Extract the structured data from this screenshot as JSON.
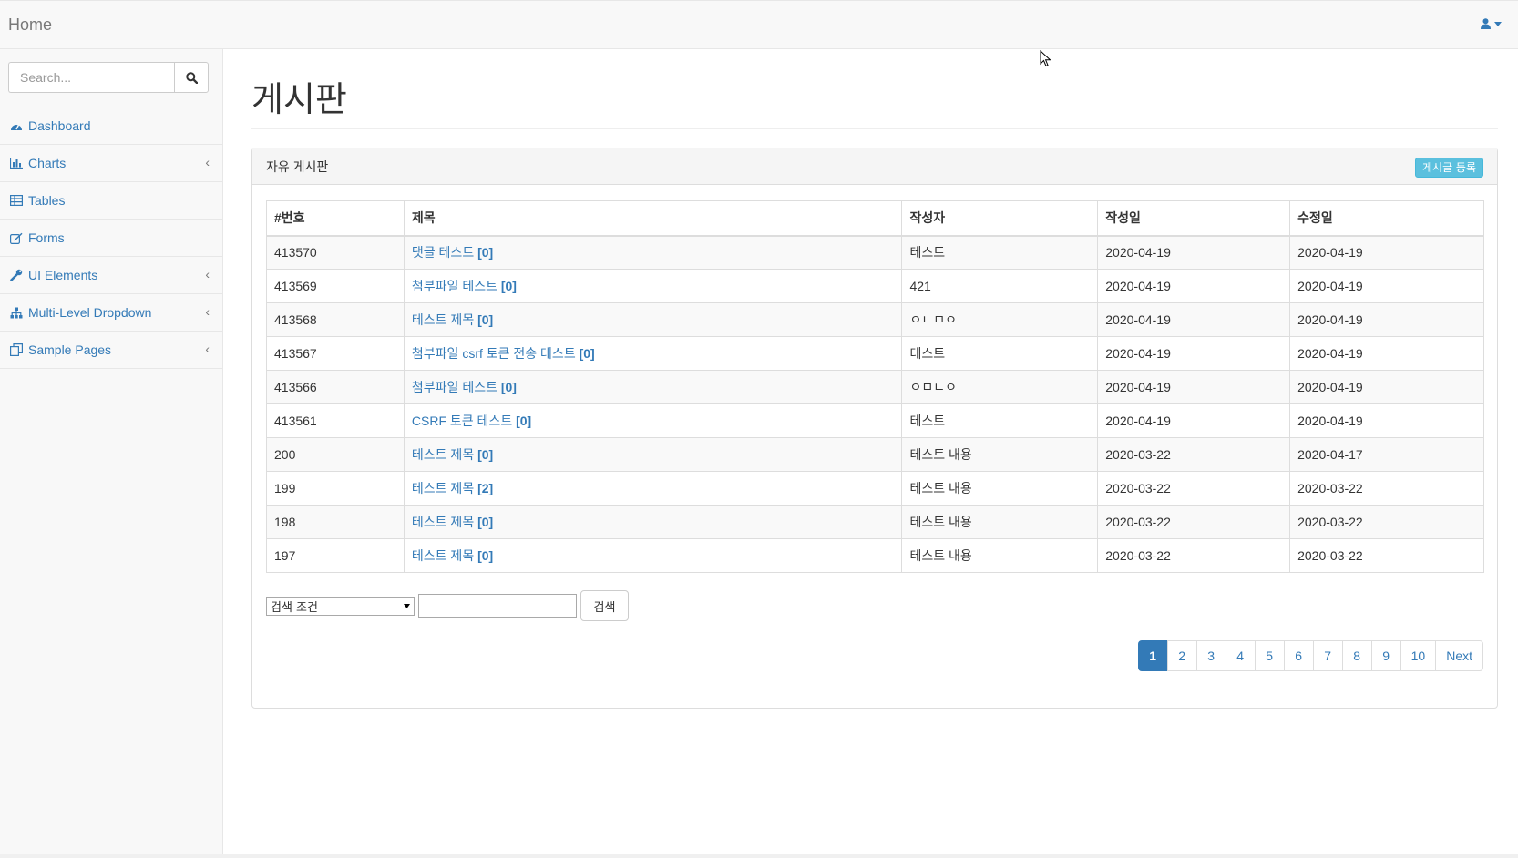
{
  "navbar": {
    "brand": "Home"
  },
  "sidebar": {
    "search_placeholder": "Search...",
    "items": [
      {
        "label": "Dashboard",
        "icon": "dashboard-icon",
        "has_children": false
      },
      {
        "label": "Charts",
        "icon": "bar-chart-icon",
        "has_children": true
      },
      {
        "label": "Tables",
        "icon": "table-icon",
        "has_children": false
      },
      {
        "label": "Forms",
        "icon": "edit-icon",
        "has_children": false
      },
      {
        "label": "UI Elements",
        "icon": "wrench-icon",
        "has_children": true
      },
      {
        "label": "Multi-Level Dropdown",
        "icon": "sitemap-icon",
        "has_children": true
      },
      {
        "label": "Sample Pages",
        "icon": "files-icon",
        "has_children": true
      }
    ]
  },
  "page": {
    "title": "게시판"
  },
  "board": {
    "heading": "자유 게시판",
    "register_label": "게시글 등록",
    "columns": [
      "#번호",
      "제목",
      "작성자",
      "작성일",
      "수정일"
    ],
    "rows": [
      {
        "no": "413570",
        "title": "댓글 테스트",
        "count": "[0]",
        "writer": "테스트",
        "created": "2020-04-19",
        "updated": "2020-04-19"
      },
      {
        "no": "413569",
        "title": "첨부파일 테스트",
        "count": "[0]",
        "writer": "421",
        "created": "2020-04-19",
        "updated": "2020-04-19"
      },
      {
        "no": "413568",
        "title": "테스트 제목",
        "count": "[0]",
        "writer": "ㅇㄴㅁㅇ",
        "created": "2020-04-19",
        "updated": "2020-04-19"
      },
      {
        "no": "413567",
        "title": "첨부파일 csrf 토큰 전송 테스트",
        "count": "[0]",
        "writer": "테스트",
        "created": "2020-04-19",
        "updated": "2020-04-19"
      },
      {
        "no": "413566",
        "title": "첨부파일 테스트",
        "count": "[0]",
        "writer": "ㅇㅁㄴㅇ",
        "created": "2020-04-19",
        "updated": "2020-04-19"
      },
      {
        "no": "413561",
        "title": "CSRF 토큰 테스트",
        "count": "[0]",
        "writer": "테스트",
        "created": "2020-04-19",
        "updated": "2020-04-19"
      },
      {
        "no": "200",
        "title": "테스트 제목",
        "count": "[0]",
        "writer": "테스트 내용",
        "created": "2020-03-22",
        "updated": "2020-04-17"
      },
      {
        "no": "199",
        "title": "테스트 제목",
        "count": "[2]",
        "writer": "테스트 내용",
        "created": "2020-03-22",
        "updated": "2020-03-22"
      },
      {
        "no": "198",
        "title": "테스트 제목",
        "count": "[0]",
        "writer": "테스트 내용",
        "created": "2020-03-22",
        "updated": "2020-03-22"
      },
      {
        "no": "197",
        "title": "테스트 제목",
        "count": "[0]",
        "writer": "테스트 내용",
        "created": "2020-03-22",
        "updated": "2020-03-22"
      }
    ],
    "search": {
      "condition_selected": "검색 조건",
      "keyword_value": "",
      "button_label": "검색"
    },
    "pagination": {
      "pages": [
        "1",
        "2",
        "3",
        "4",
        "5",
        "6",
        "7",
        "8",
        "9",
        "10"
      ],
      "active": "1",
      "next_label": "Next"
    }
  },
  "colors": {
    "link": "#337ab7",
    "info": "#5bc0de"
  }
}
